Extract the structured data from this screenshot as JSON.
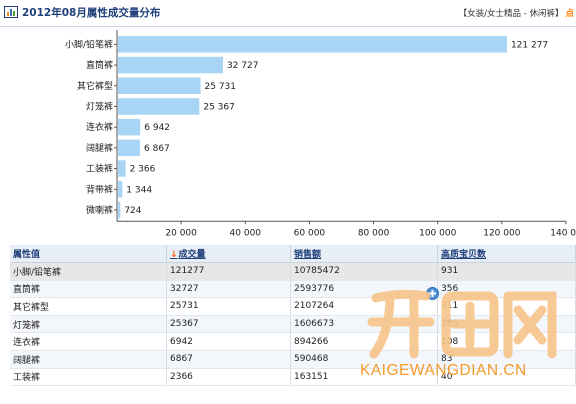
{
  "header": {
    "title": "2012年08月属性成交量分布",
    "breadcrumb": "【女装/女士精品 - 休闲裤】",
    "breadcrumb_tail": "点"
  },
  "chart_data": {
    "type": "bar",
    "orientation": "horizontal",
    "categories": [
      "小脚/铅笔裤",
      "直筒裤",
      "其它裤型",
      "灯笼裤",
      "连衣裤",
      "阔腿裤",
      "工装裤",
      "背带裤",
      "微喇裤"
    ],
    "values": [
      121277,
      32727,
      25731,
      25367,
      6942,
      6867,
      2366,
      1344,
      724
    ],
    "value_labels": [
      "121 277",
      "32 727",
      "25 731",
      "25 367",
      "6 942",
      "6 867",
      "2 366",
      "1 344",
      "724"
    ],
    "xlim": [
      0,
      140000
    ],
    "xticks": [
      20000,
      40000,
      60000,
      80000,
      100000,
      120000,
      140000
    ],
    "xtick_labels": [
      "20 000",
      "40 000",
      "60 000",
      "80 000",
      "100 000",
      "120 000",
      "140 00"
    ],
    "bar_color": "#a8d4f5",
    "grid": false
  },
  "table": {
    "columns": [
      "属性值",
      "成交量",
      "销售额",
      "高质宝贝数"
    ],
    "sort_icon": "down-arrow-icon",
    "rows": [
      [
        "小脚/铅笔裤",
        "121277",
        "10785472",
        "931"
      ],
      [
        "直筒裤",
        "32727",
        "2593776",
        "356"
      ],
      [
        "其它裤型",
        "25731",
        "2107264",
        "311"
      ],
      [
        "灯笼裤",
        "25367",
        "1606673",
        "265"
      ],
      [
        "连衣裤",
        "6942",
        "894266",
        "108"
      ],
      [
        "阔腿裤",
        "6867",
        "590468",
        "83"
      ],
      [
        "工装裤",
        "2366",
        "163151",
        "40"
      ]
    ]
  },
  "watermark": {
    "text": "KAIGEWANGDIAN.CN",
    "logo": "开店网",
    "color": "#f39a2a"
  }
}
